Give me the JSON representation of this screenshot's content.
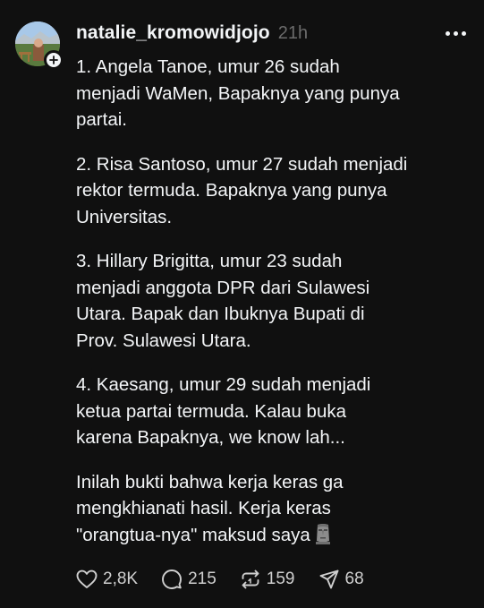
{
  "post": {
    "username": "natalie_kromowidjojo",
    "time_ago": "21h",
    "paragraphs": [
      [
        "1. Angela Tanoe, umur 26 sudah",
        "menjadi WaMen, Bapaknya yang punya",
        "partai."
      ],
      [
        "2. Risa Santoso, umur 27 sudah menjadi",
        "rektor termuda. Bapaknya yang punya",
        "Universitas."
      ],
      [
        "3. Hillary Brigitta, umur 23 sudah",
        "menjadi anggota DPR dari Sulawesi",
        "Utara. Bapak dan Ibuknya Bupati di",
        "Prov. Sulawesi Utara."
      ],
      [
        "4. Kaesang, umur 29 sudah menjadi",
        "ketua partai termuda. Kalau buka",
        "karena Bapaknya, we know lah..."
      ],
      [
        "Inilah bukti bahwa kerja keras ga",
        "mengkhianati hasil. Kerja keras",
        "\"orangtua-nya\" maksud saya"
      ]
    ],
    "end_emoji": "moai-emoji",
    "actions": {
      "likes": "2,8K",
      "replies": "215",
      "reposts": "159",
      "shares": "68"
    }
  },
  "icons": {
    "like": "heart-icon",
    "reply": "speech-bubble-icon",
    "repost": "repost-arrows-icon",
    "share": "paper-plane-icon",
    "follow": "plus-icon",
    "more": "ellipsis-icon"
  },
  "colors": {
    "background": "#101010",
    "text": "#f3f5f7",
    "secondary_text": "#6b6b6b"
  }
}
